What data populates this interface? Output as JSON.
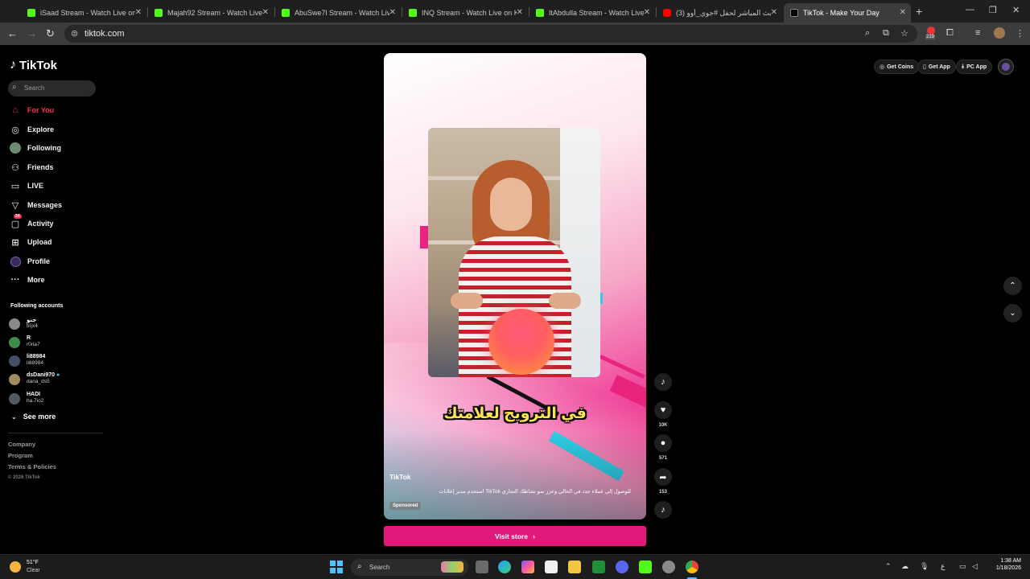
{
  "browser": {
    "tabs": [
      {
        "title": "iSaad Stream - Watch Live on K",
        "icon": "kick-icon"
      },
      {
        "title": "Majah92 Stream - Watch Live o",
        "icon": "kick-icon"
      },
      {
        "title": "AbuSwe7l Stream - Watch Live",
        "icon": "kick-icon"
      },
      {
        "title": "INQ Stream - Watch Live on Ki",
        "icon": "kick-icon"
      },
      {
        "title": "ItAbdulla Stream - Watch Live o",
        "icon": "kick-icon"
      },
      {
        "title": "(3) البث المباشر لحفل #جوي_أوو",
        "icon": "youtube-icon"
      },
      {
        "title": "TikTok - Make Your Day",
        "icon": "tiktok-icon",
        "active": true
      }
    ],
    "url": "tiktok.com",
    "extension_badge": "219"
  },
  "tiktok": {
    "logo_text": "TikTok",
    "search_placeholder": "Search",
    "nav": [
      {
        "label": "For You",
        "icon": "home-icon",
        "active": true
      },
      {
        "label": "Explore",
        "icon": "compass-icon"
      },
      {
        "label": "Following",
        "icon": "following-avatar-icon"
      },
      {
        "label": "Friends",
        "icon": "friends-icon"
      },
      {
        "label": "LIVE",
        "icon": "live-icon"
      },
      {
        "label": "Messages",
        "icon": "messages-icon"
      },
      {
        "label": "Activity",
        "icon": "activity-icon",
        "badge": "24"
      },
      {
        "label": "Upload",
        "icon": "upload-icon"
      },
      {
        "label": "Profile",
        "icon": "profile-avatar-icon"
      },
      {
        "label": "More",
        "icon": "more-icon"
      }
    ],
    "following_title": "Following accounts",
    "following_accounts": [
      {
        "name": "جنو",
        "handle": "trijx4"
      },
      {
        "name": "R",
        "handle": "r0ria7"
      },
      {
        "name": "li88984",
        "handle": "li88984"
      },
      {
        "name": "dsDani970",
        "handle": "dana_ds5"
      },
      {
        "name": "HADI",
        "handle": "ha.7io2"
      }
    ],
    "see_more": "See more",
    "footer": [
      "Company",
      "Program",
      "Terms & Policies"
    ],
    "copyright": "© 2026 TikTok",
    "header": {
      "get_coins": "Get Coins",
      "get_app": "Get App",
      "pc_app": "PC App"
    },
    "video": {
      "caption_overlay": "في الترويج لعلامتك",
      "author": "TikTok",
      "description": "للوصول إلى عملاء جدد في الحالي وعزز نمو نشاطك التجاري TikTok استخدم مدير إعلانات",
      "sponsored": "Sponsored",
      "likes": "10K",
      "comments": "571",
      "shares": "153"
    },
    "cta": "Visit store"
  },
  "taskbar": {
    "weather_temp": "51°F",
    "weather_cond": "Clear",
    "search_placeholder": "Search",
    "time": "1:38 AM",
    "date": "1/18/2026"
  },
  "colors": {
    "accent": "#fe2c55",
    "cta": "#e0197a",
    "kick": "#53fc18"
  }
}
